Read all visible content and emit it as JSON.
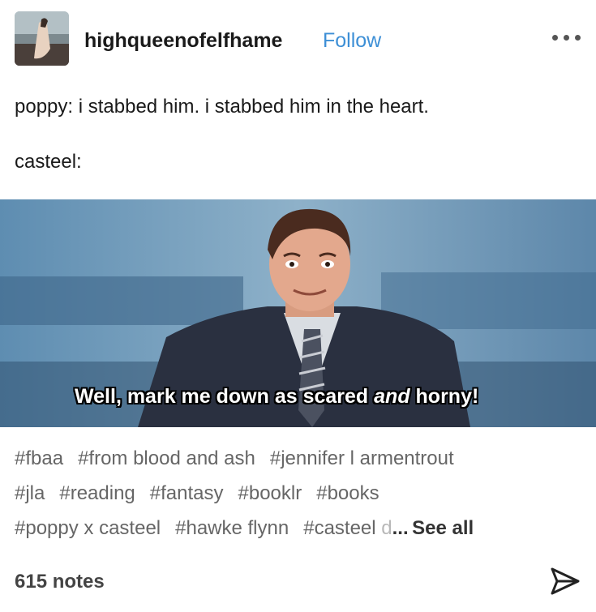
{
  "post": {
    "username": "highqueenofelfhame",
    "follow_label": "Follow",
    "more_icon": "more-dots-icon",
    "line1": "poppy: i stabbed him. i stabbed him in the heart.",
    "line2": "casteel:"
  },
  "gif": {
    "caption_part1": "Well, mark me down as scared ",
    "caption_italic": "and",
    "caption_part2": " horny!"
  },
  "tags": {
    "row1": [
      "#fbaa",
      "#from blood and ash",
      "#jennifer l armentrout"
    ],
    "row2": [
      "#jla",
      "#reading",
      "#fantasy",
      "#booklr",
      "#books"
    ],
    "row3": [
      "#poppy x casteel",
      "#hawke flynn"
    ],
    "truncated_tag": "#casteel",
    "truncated_fade": " d",
    "ellipsis": "...",
    "see_all": "See all"
  },
  "footer": {
    "notes": "615 notes",
    "share_icon": "share-send-icon"
  },
  "colors": {
    "follow": "#3d8fd6",
    "tag": "#666666",
    "gif_bg": "#6f97b6"
  }
}
